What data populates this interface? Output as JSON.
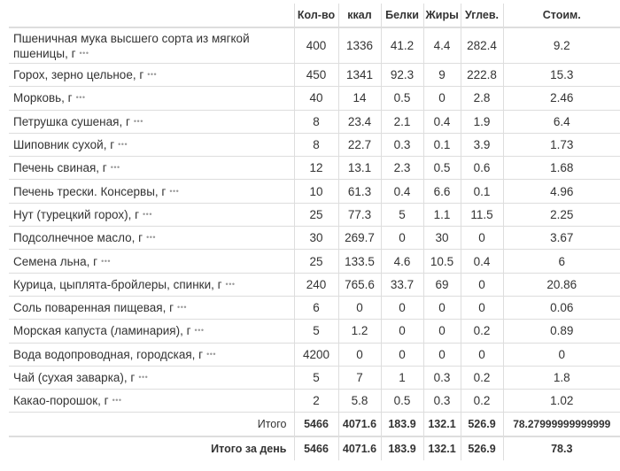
{
  "table": {
    "headers": [
      "",
      "Кол-во",
      "ккал",
      "Белки",
      "Жиры",
      "Углев.",
      "Стоим."
    ],
    "more_glyph": "•••",
    "rows": [
      {
        "name": "Пшеничная мука высшего сорта из мягкой пшеницы, г",
        "qty": "400",
        "kcal": "1336",
        "protein": "41.2",
        "fat": "4.4",
        "carbs": "282.4",
        "cost": "9.2"
      },
      {
        "name": "Горох, зерно цельное, г",
        "qty": "450",
        "kcal": "1341",
        "protein": "92.3",
        "fat": "9",
        "carbs": "222.8",
        "cost": "15.3"
      },
      {
        "name": "Морковь, г",
        "qty": "40",
        "kcal": "14",
        "protein": "0.5",
        "fat": "0",
        "carbs": "2.8",
        "cost": "2.46"
      },
      {
        "name": "Петрушка сушеная, г",
        "qty": "8",
        "kcal": "23.4",
        "protein": "2.1",
        "fat": "0.4",
        "carbs": "1.9",
        "cost": "6.4"
      },
      {
        "name": "Шиповник сухой, г",
        "qty": "8",
        "kcal": "22.7",
        "protein": "0.3",
        "fat": "0.1",
        "carbs": "3.9",
        "cost": "1.73"
      },
      {
        "name": "Печень свиная, г",
        "qty": "12",
        "kcal": "13.1",
        "protein": "2.3",
        "fat": "0.5",
        "carbs": "0.6",
        "cost": "1.68"
      },
      {
        "name": "Печень трески. Консервы, г",
        "qty": "10",
        "kcal": "61.3",
        "protein": "0.4",
        "fat": "6.6",
        "carbs": "0.1",
        "cost": "4.96"
      },
      {
        "name": "Нут (турецкий горох), г",
        "qty": "25",
        "kcal": "77.3",
        "protein": "5",
        "fat": "1.1",
        "carbs": "11.5",
        "cost": "2.25"
      },
      {
        "name": "Подсолнечное масло, г",
        "qty": "30",
        "kcal": "269.7",
        "protein": "0",
        "fat": "30",
        "carbs": "0",
        "cost": "3.67"
      },
      {
        "name": "Семена льна, г",
        "qty": "25",
        "kcal": "133.5",
        "protein": "4.6",
        "fat": "10.5",
        "carbs": "0.4",
        "cost": "6"
      },
      {
        "name": "Курица, цыплята-бройлеры, спинки, г",
        "qty": "240",
        "kcal": "765.6",
        "protein": "33.7",
        "fat": "69",
        "carbs": "0",
        "cost": "20.86"
      },
      {
        "name": "Соль поваренная пищевая, г",
        "qty": "6",
        "kcal": "0",
        "protein": "0",
        "fat": "0",
        "carbs": "0",
        "cost": "0.06"
      },
      {
        "name": "Морская капуста (ламинария), г",
        "qty": "5",
        "kcal": "1.2",
        "protein": "0",
        "fat": "0",
        "carbs": "0.2",
        "cost": "0.89"
      },
      {
        "name": "Вода водопроводная, городская, г",
        "qty": "4200",
        "kcal": "0",
        "protein": "0",
        "fat": "0",
        "carbs": "0",
        "cost": "0"
      },
      {
        "name": "Чай (сухая заварка), г",
        "qty": "5",
        "kcal": "7",
        "protein": "1",
        "fat": "0.3",
        "carbs": "0.2",
        "cost": "1.8"
      },
      {
        "name": "Какао-порошок, г",
        "qty": "2",
        "kcal": "5.8",
        "protein": "0.5",
        "fat": "0.3",
        "carbs": "0.2",
        "cost": "1.02"
      }
    ],
    "total": {
      "label": "Итого",
      "qty": "5466",
      "kcal": "4071.6",
      "protein": "183.9",
      "fat": "132.1",
      "carbs": "526.9",
      "cost": "78.27999999999999"
    },
    "day_total": {
      "label": "Итого за день",
      "qty": "5466",
      "kcal": "4071.6",
      "protein": "183.9",
      "fat": "132.1",
      "carbs": "526.9",
      "cost": "78.3"
    }
  }
}
